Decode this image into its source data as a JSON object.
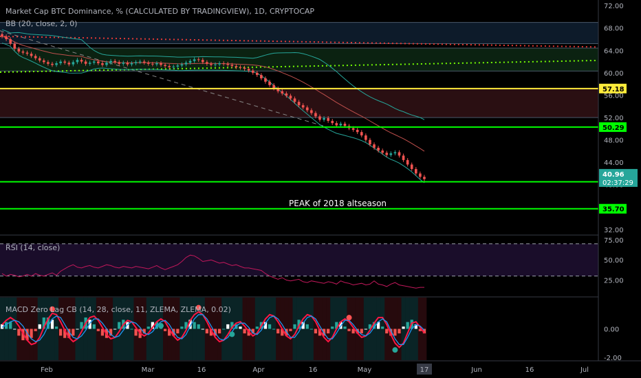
{
  "chart_data": [
    {
      "type": "candlestick",
      "panel": "price",
      "title": "Market Cap BTC Dominance, % (CALCULATED BY TRADINGVIEW), 1D, CRYPTOCAP",
      "indicator_label": "BB (20, close, 2, 0)",
      "y_ticks": [
        "72.00",
        "68.00",
        "64.00",
        "60.00",
        "56.00",
        "52.00",
        "48.00",
        "44.00",
        "40.00",
        "36.00",
        "32.00"
      ],
      "ylim": [
        31,
        73
      ],
      "x_ticks": [
        "Feb",
        "Mar",
        "16",
        "Apr",
        "16",
        "May",
        "16",
        "17",
        "Jun",
        "16",
        "Jul"
      ],
      "horizontal_levels": [
        {
          "value": 57.18,
          "label": "57.18",
          "color": "#ffeb3b"
        },
        {
          "value": 50.29,
          "label": "50.29",
          "color": "#00ff00"
        },
        {
          "value": 40.51,
          "label": "40.51",
          "color": "#00ff00"
        },
        {
          "value": 35.7,
          "label": "35.70",
          "color": "#00ff00"
        }
      ],
      "last_price": {
        "value": "40.96",
        "countdown": "02:37:29"
      },
      "annotation": "PEAK of 2018 altseason",
      "close_series": [
        66.5,
        66.0,
        65.2,
        64.3,
        63.8,
        63.6,
        63.4,
        63.0,
        62.6,
        62.2,
        61.9,
        61.6,
        61.4,
        61.7,
        62.0,
        61.8,
        61.5,
        61.9,
        62.3,
        62.0,
        61.6,
        61.8,
        62.0,
        61.7,
        61.4,
        61.8,
        62.1,
        61.9,
        61.6,
        61.8,
        61.5,
        61.7,
        61.9,
        62.0,
        61.8,
        61.6,
        61.5,
        61.7,
        61.4,
        61.2,
        61.0,
        61.1,
        61.3,
        61.5,
        61.8,
        62.1,
        62.4,
        62.3,
        61.9,
        61.6,
        61.4,
        61.5,
        61.7,
        61.6,
        61.4,
        61.2,
        61.0,
        60.9,
        60.7,
        60.4,
        60.0,
        59.6,
        59.0,
        58.4,
        57.8,
        57.2,
        56.7,
        56.3,
        55.9,
        55.4,
        54.8,
        54.2,
        53.8,
        53.3,
        52.8,
        52.2,
        51.6,
        51.9,
        51.4,
        51.0,
        50.6,
        50.9,
        50.5,
        50.1,
        49.8,
        49.4,
        48.8,
        48.0,
        47.2,
        46.6,
        46.1,
        45.7,
        45.3,
        45.6,
        45.8,
        45.2,
        44.4,
        43.6,
        42.8,
        42.0,
        41.4,
        41.0
      ]
    },
    {
      "type": "line",
      "panel": "rsi",
      "title": "RSI (14, close)",
      "y_ticks": [
        "75.00",
        "50.00",
        "25.00"
      ],
      "ylim": [
        5,
        80
      ],
      "bands": [
        70,
        30
      ],
      "values": [
        33,
        30,
        32,
        31,
        29,
        30,
        32,
        30,
        33,
        31,
        30,
        32,
        34,
        31,
        36,
        39,
        42,
        44,
        41,
        40,
        42,
        43,
        41,
        40,
        42,
        44,
        43,
        41,
        40,
        42,
        41,
        40,
        42,
        41,
        40,
        39,
        41,
        43,
        40,
        38,
        40,
        42,
        44,
        48,
        53,
        56,
        55,
        52,
        48,
        49,
        50,
        48,
        46,
        47,
        45,
        43,
        44,
        42,
        40,
        40,
        39,
        38,
        37,
        33,
        30,
        28,
        26,
        28,
        25,
        24,
        25,
        26,
        23,
        22,
        24,
        23,
        22,
        21,
        23,
        22,
        20,
        24,
        22,
        21,
        19,
        20,
        21,
        19,
        20,
        24,
        20,
        19,
        17,
        20,
        22,
        19,
        18,
        17,
        16,
        15,
        16,
        16
      ]
    },
    {
      "type": "line",
      "panel": "macd",
      "title": "MACD Zero Lag CB (14, 28, close, 11, ZLEMA, ZLEMA, 0.02)",
      "y_ticks": [
        "0.00",
        "-2.00"
      ],
      "ylim": [
        -2.2,
        2.2
      ],
      "series": [
        {
          "color": "#ff1744",
          "values": [
            0.3,
            0.6,
            0.8,
            0.6,
            0.2,
            -0.3,
            -0.8,
            -1.1,
            -1.0,
            -0.6,
            0.1,
            0.7,
            1.1,
            1.0,
            0.5,
            -0.1,
            -0.6,
            -0.9,
            -0.7,
            -0.2,
            0.4,
            0.8,
            0.9,
            0.6,
            0.1,
            -0.4,
            -0.7,
            -0.6,
            -0.2,
            0.3,
            0.6,
            0.5,
            0.1,
            -0.3,
            -0.5,
            -0.3,
            0.1,
            0.5,
            0.7,
            0.5,
            0.0,
            -0.5,
            -0.8,
            -0.6,
            -0.1,
            0.6,
            1.0,
            1.2,
            1.0,
            0.5,
            -0.1,
            -0.6,
            -0.9,
            -0.8,
            -0.4,
            0.1,
            0.4,
            0.5,
            0.2,
            -0.2,
            -0.5,
            -0.3,
            0.2,
            0.7,
            1.0,
            0.9,
            0.5,
            0.0,
            -0.5,
            -0.7,
            -0.4,
            0.2,
            0.7,
            1.0,
            0.9,
            0.5,
            -0.1,
            -0.6,
            -0.9,
            -0.6,
            0.0,
            0.5,
            0.7,
            0.5,
            0.1,
            -0.3,
            -0.6,
            -0.5,
            -0.1,
            0.4,
            0.8,
            0.8,
            0.3,
            -0.4,
            -1.0,
            -1.3,
            -1.0,
            -0.3,
            0.4,
            0.5,
            0.1,
            -0.3
          ]
        },
        {
          "color": "#2196f3",
          "values": [
            0.1,
            0.3,
            0.5,
            0.6,
            0.5,
            0.2,
            -0.3,
            -0.7,
            -0.9,
            -0.8,
            -0.4,
            0.2,
            0.7,
            0.9,
            0.8,
            0.3,
            -0.2,
            -0.6,
            -0.7,
            -0.5,
            -0.1,
            0.4,
            0.7,
            0.7,
            0.4,
            0.0,
            -0.4,
            -0.6,
            -0.5,
            -0.1,
            0.3,
            0.5,
            0.4,
            0.1,
            -0.3,
            -0.4,
            -0.2,
            0.2,
            0.5,
            0.6,
            0.3,
            -0.2,
            -0.6,
            -0.7,
            -0.4,
            0.2,
            0.7,
            1.0,
            1.0,
            0.7,
            0.2,
            -0.3,
            -0.7,
            -0.8,
            -0.6,
            -0.2,
            0.2,
            0.4,
            0.4,
            0.1,
            -0.3,
            -0.4,
            -0.1,
            0.4,
            0.8,
            0.9,
            0.7,
            0.3,
            -0.2,
            -0.6,
            -0.6,
            -0.2,
            0.4,
            0.8,
            0.9,
            0.7,
            0.2,
            -0.3,
            -0.7,
            -0.7,
            -0.3,
            0.2,
            0.6,
            0.6,
            0.3,
            -0.1,
            -0.4,
            -0.5,
            -0.3,
            0.1,
            0.5,
            0.7,
            0.5,
            -0.1,
            -0.7,
            -1.1,
            -1.1,
            -0.6,
            0.0,
            0.3,
            0.2,
            -0.1
          ]
        }
      ],
      "markers": [
        {
          "index": 12,
          "type": "peak"
        },
        {
          "index": 38,
          "type": "trough"
        },
        {
          "index": 47,
          "type": "peak"
        },
        {
          "index": 55,
          "type": "trough"
        },
        {
          "index": 83,
          "type": "peak"
        },
        {
          "index": 94,
          "type": "trough"
        }
      ]
    }
  ]
}
